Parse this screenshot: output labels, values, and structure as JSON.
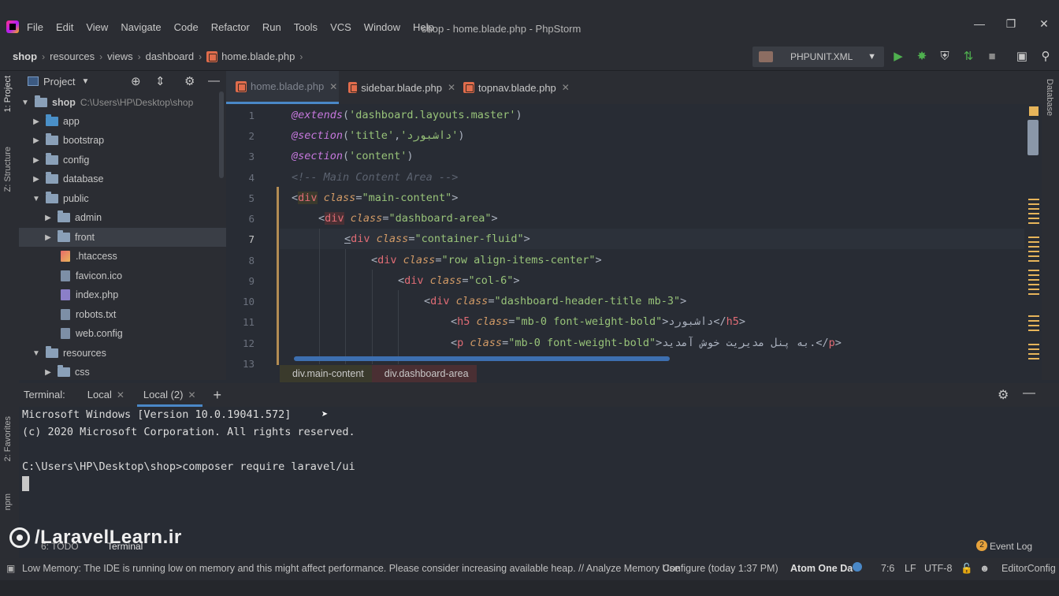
{
  "app": {
    "window_title": "shop - home.blade.php - PhpStorm",
    "menu": [
      "File",
      "Edit",
      "View",
      "Navigate",
      "Code",
      "Refactor",
      "Run",
      "Tools",
      "VCS",
      "Window",
      "Help"
    ]
  },
  "navbar": {
    "breadcrumb": [
      "shop",
      "resources",
      "views",
      "dashboard",
      "home.blade.php"
    ],
    "run_config": "PHPUNIT.XML"
  },
  "left_strip": {
    "project_tab": "1: Project",
    "structure_tab": "Z: Structure",
    "favorites_tab": "2: Favorites",
    "npm_tab": "npm"
  },
  "right_strip": {
    "database_tab": "Database"
  },
  "project": {
    "header": "Project",
    "root_name": "shop",
    "root_path": "C:\\Users\\HP\\Desktop\\shop",
    "items": [
      {
        "label": "app"
      },
      {
        "label": "bootstrap"
      },
      {
        "label": "config"
      },
      {
        "label": "database"
      },
      {
        "label": "public"
      },
      {
        "label": "admin"
      },
      {
        "label": "front"
      },
      {
        "label": ".htaccess"
      },
      {
        "label": "favicon.ico"
      },
      {
        "label": "index.php"
      },
      {
        "label": "robots.txt"
      },
      {
        "label": "web.config"
      },
      {
        "label": "resources"
      },
      {
        "label": "css"
      }
    ]
  },
  "editor": {
    "tabs": [
      "home.blade.php",
      "sidebar.blade.php",
      "topnav.blade.php"
    ],
    "line_numbers": [
      "1",
      "2",
      "3",
      "4",
      "5",
      "6",
      "7",
      "8",
      "9",
      "10",
      "11",
      "12",
      "13"
    ],
    "code": {
      "l1": {
        "directive": "@extends",
        "open": "(",
        "arg": "'dashboard.layouts.master'",
        "close": ")"
      },
      "l2": {
        "directive": "@section",
        "open": "(",
        "arg1": "'title'",
        "comma": ",",
        "arg2": "'داشبورد'",
        "close": ")"
      },
      "l3": {
        "directive": "@section",
        "open": "(",
        "arg": "'content'",
        "close": ")"
      },
      "l4": {
        "comment": "<!-- Main Content Area -->"
      },
      "l5": {
        "lt": "<",
        "tag": "div",
        "attr": "class",
        "eq": "=",
        "val": "\"main-content\"",
        "gt": ">"
      },
      "l6": {
        "lt": "<",
        "tag": "div",
        "attr": "class",
        "eq": "=",
        "val": "\"dashboard-area\"",
        "gt": ">"
      },
      "l7": {
        "lt": "<",
        "tag": "div",
        "attr": "class",
        "eq": "=",
        "val": "\"container-fluid\"",
        "gt": ">"
      },
      "l8": {
        "lt": "<",
        "tag": "div",
        "attr": "class",
        "eq": "=",
        "val": "\"row align-items-center\"",
        "gt": ">"
      },
      "l9": {
        "lt": "<",
        "tag": "div",
        "attr": "class",
        "eq": "=",
        "val": "\"col-6\"",
        "gt": ">"
      },
      "l10": {
        "lt": "<",
        "tag": "div",
        "attr": "class",
        "eq": "=",
        "val": "\"dashboard-header-title mb-3\"",
        "gt": ">"
      },
      "l11": {
        "lt": "<",
        "tag": "h5",
        "attr": "class",
        "eq": "=",
        "val": "\"mb-0 font-weight-bold\"",
        "text": ">داشبورد</",
        "ctag": "h5",
        "gt": ">"
      },
      "l12": {
        "lt": "<",
        "tag": "p",
        "attr": "class",
        "eq": "=",
        "val": "\"mb-0 font-weight-bold\"",
        "text": ">به پنل مدیریت خوش آمدید.</",
        "ctag": "p",
        "gt": ">"
      }
    },
    "breadcrumbs": [
      "div.main-content",
      "div.dashboard-area"
    ]
  },
  "terminal": {
    "label": "Terminal:",
    "tabs": [
      "Local",
      "Local (2)"
    ],
    "lines": [
      "Microsoft Windows [Version 10.0.19041.572]",
      "(c) 2020 Microsoft Corporation. All rights reserved.",
      "",
      "C:\\Users\\HP\\Desktop\\shop>composer require laravel/ui"
    ]
  },
  "bottom_tools": {
    "todo": "6: TODO",
    "terminal": "Terminal",
    "event_log_count": "2",
    "event_log": "Event Log"
  },
  "watermark": "/LaravelLearn.ir",
  "status": {
    "message": "Low Memory: The IDE is running low on memory and this might affect performance. Please consider increasing available heap. // Analyze Memory Use",
    "configure": "Configure (today 1:37 PM)",
    "theme": "Atom One Da",
    "position": "7:6",
    "line_sep": "LF",
    "encoding": "UTF-8",
    "editorconfig": "EditorConfig"
  },
  "colors": {
    "accent": "#4a88c7",
    "editor_bg": "#282c34",
    "panel_bg": "#2b2d33",
    "keyword": "#c678dd",
    "string": "#98c379",
    "tag": "#e06c75",
    "attribute": "#d19a66"
  }
}
